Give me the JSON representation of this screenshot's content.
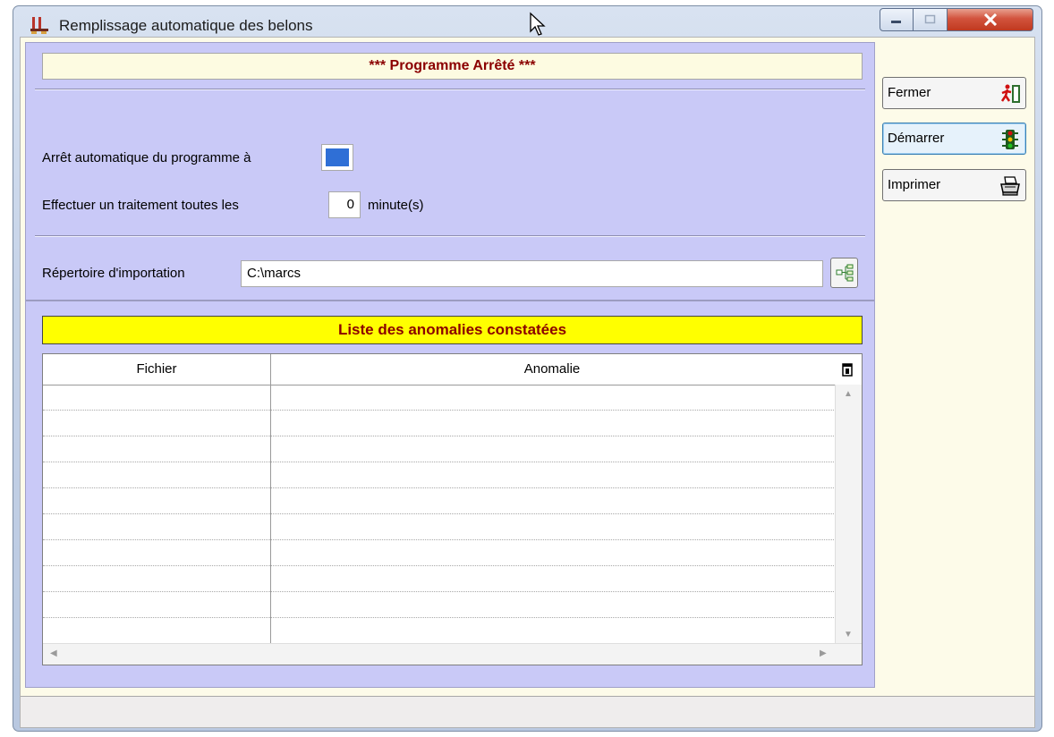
{
  "window": {
    "title": "Remplissage automatique des belons"
  },
  "status_banner": "*** Programme Arrêté ***",
  "settings": {
    "auto_stop_label": "Arrêt automatique du programme à",
    "interval_label": "Effectuer un traitement toutes les",
    "interval_value": "0",
    "interval_unit": "minute(s)",
    "import_dir_label": "Répertoire d'importation",
    "import_dir_value": "C:\\marcs"
  },
  "anomalies": {
    "title": "Liste des anomalies constatées",
    "columns": [
      "Fichier",
      "Anomalie"
    ],
    "rows": []
  },
  "buttons": {
    "close": "Fermer",
    "start": "Démarrer",
    "print": "Imprimer"
  },
  "colors": {
    "panel": "#c9c9f7",
    "client": "#fdfbe9",
    "banner_text": "#8b0000",
    "anomaly_header": "#ffff00"
  }
}
